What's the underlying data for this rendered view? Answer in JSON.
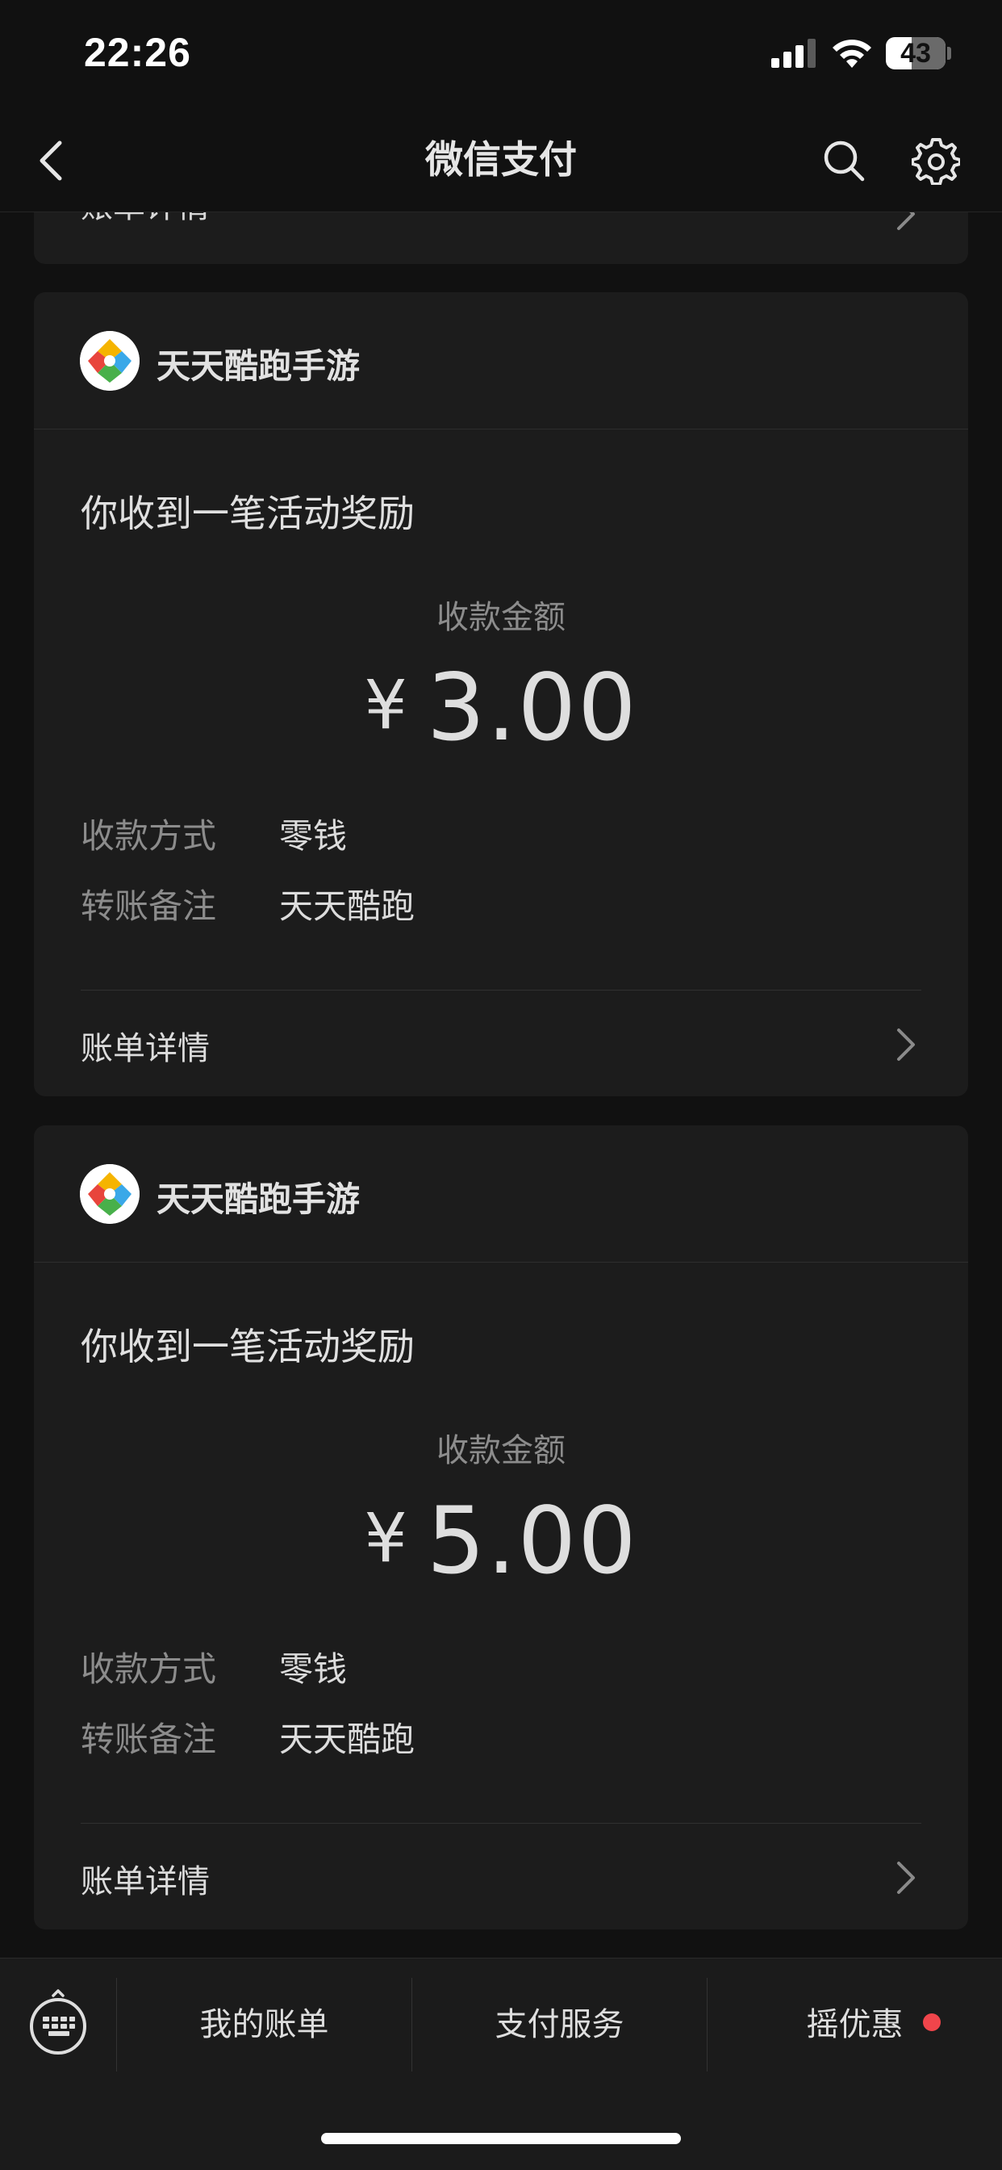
{
  "status_bar": {
    "time": "22:26",
    "battery_level": "43",
    "battery_fraction": 0.43
  },
  "nav": {
    "title": "微信支付",
    "back_icon": "chevron-left-icon",
    "search_icon": "search-icon",
    "settings_icon": "gear-icon"
  },
  "previous_card": {
    "detail_label": "账单详情"
  },
  "cards": [
    {
      "app_name": "天天酷跑手游",
      "notice": "你收到一笔活动奖励",
      "amount_label": "收款金额",
      "currency": "¥",
      "amount": "3.00",
      "method_key": "收款方式",
      "method_value": "零钱",
      "remark_key": "转账备注",
      "remark_value": "天天酷跑",
      "detail_label": "账单详情"
    },
    {
      "app_name": "天天酷跑手游",
      "notice": "你收到一笔活动奖励",
      "amount_label": "收款金额",
      "currency": "¥",
      "amount": "5.00",
      "method_key": "收款方式",
      "method_value": "零钱",
      "remark_key": "转账备注",
      "remark_value": "天天酷跑",
      "detail_label": "账单详情"
    }
  ],
  "tab_bar": {
    "keyboard_icon": "keyboard-icon",
    "tabs": [
      "我的账单",
      "支付服务",
      "摇优惠"
    ],
    "badge_color": "#f0454b"
  },
  "colors": {
    "background": "#111111",
    "card": "#1c1c1c",
    "accent_red": "#f0454b"
  }
}
